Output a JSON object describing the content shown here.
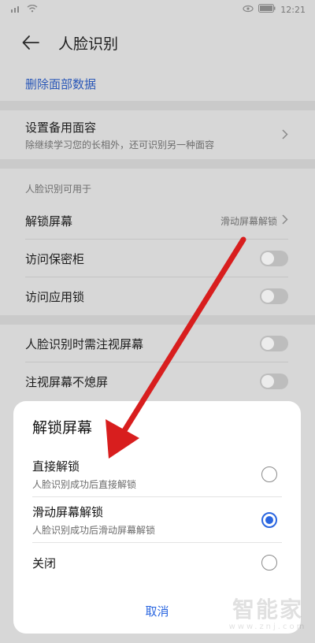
{
  "status_bar": {
    "time": "12:21"
  },
  "header": {
    "title": "人脸识别"
  },
  "delete_link": "删除面部数据",
  "backup_face": {
    "title": "设置备用面容",
    "subtitle": "除继续学习您的长相外，还可识别另一种面容"
  },
  "section_label": "人脸识别可用于",
  "settings": {
    "unlock": {
      "label": "解锁屏幕",
      "value": "滑动屏幕解锁"
    },
    "vault": {
      "label": "访问保密柜"
    },
    "app_lock": {
      "label": "访问应用锁"
    },
    "gaze": {
      "label": "人脸识别时需注视屏幕"
    },
    "screen_on": {
      "label": "注视屏幕不熄屏"
    }
  },
  "dialog": {
    "title": "解锁屏幕",
    "options": [
      {
        "title": "直接解锁",
        "subtitle": "人脸识别成功后直接解锁",
        "selected": false
      },
      {
        "title": "滑动屏幕解锁",
        "subtitle": "人脸识别成功后滑动屏幕解锁",
        "selected": true
      },
      {
        "title": "关闭",
        "selected": false
      }
    ],
    "cancel_label": "取消"
  },
  "watermark": {
    "main": "智能家",
    "sub": "www.znj.com"
  },
  "colors": {
    "accent": "#2a66e0",
    "link": "#2b58b8",
    "annotation_arrow": "#d81e1e"
  }
}
